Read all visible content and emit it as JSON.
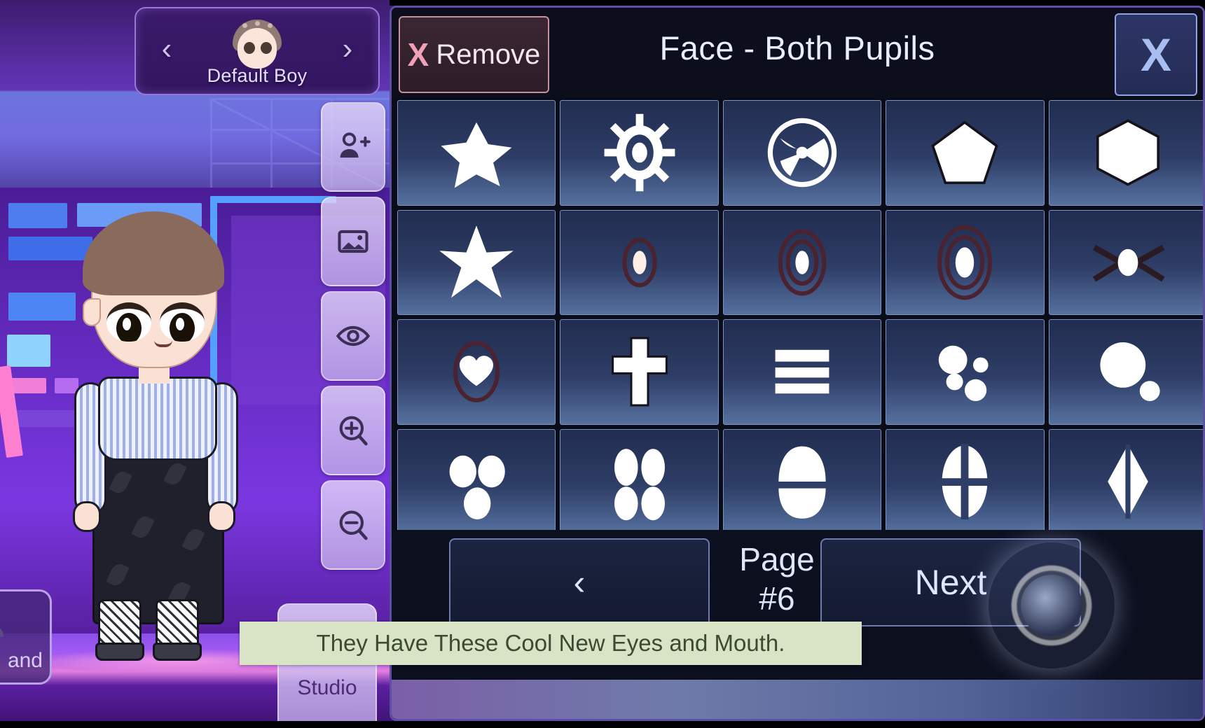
{
  "stage": {
    "selector": {
      "prev_label": "‹",
      "next_label": "›",
      "name": "Default Boy",
      "avatar_icon": "character-face-icon"
    },
    "rail": [
      {
        "name": "add-character",
        "icon": "person-plus-icon"
      },
      {
        "name": "background",
        "icon": "image-icon"
      },
      {
        "name": "preview-eye",
        "icon": "eye-icon"
      },
      {
        "name": "zoom-in",
        "icon": "magnifier-plus-icon"
      },
      {
        "name": "zoom-out",
        "icon": "magnifier-minus-icon"
      }
    ],
    "studio_button": {
      "label": "Studio",
      "icon": "camera-icon"
    },
    "rand_button": {
      "label": "and",
      "icon": "character-icon"
    }
  },
  "panel": {
    "remove_button": {
      "mark": "X",
      "label": "Remove"
    },
    "title": "Face - Both Pupils",
    "close_button": {
      "label": "X"
    },
    "items": [
      {
        "id": 1,
        "icon": "star-5-point-rough"
      },
      {
        "id": 2,
        "icon": "sun-burst-oval"
      },
      {
        "id": 3,
        "icon": "radiation-circle"
      },
      {
        "id": 4,
        "icon": "pentagon"
      },
      {
        "id": 5,
        "icon": "hexagon"
      },
      {
        "id": 6,
        "icon": "star-6-point"
      },
      {
        "id": 7,
        "icon": "oval-ring-small"
      },
      {
        "id": 8,
        "icon": "oval-double-ring"
      },
      {
        "id": 9,
        "icon": "oval-triple-ring"
      },
      {
        "id": 10,
        "icon": "sparkle-eye-lash"
      },
      {
        "id": 11,
        "icon": "heart-in-oval"
      },
      {
        "id": 12,
        "icon": "cross"
      },
      {
        "id": 13,
        "icon": "three-bars"
      },
      {
        "id": 14,
        "icon": "four-dot-cluster"
      },
      {
        "id": 15,
        "icon": "big-dot-small-dot"
      },
      {
        "id": 16,
        "icon": "three-circles"
      },
      {
        "id": 17,
        "icon": "four-ovals"
      },
      {
        "id": 18,
        "icon": "oval-split-horizontal"
      },
      {
        "id": 19,
        "icon": "oval-quartered"
      },
      {
        "id": 20,
        "icon": "diamond-split"
      }
    ],
    "footer": {
      "prev_label": "‹",
      "next_label": "Next",
      "page_label": "Page",
      "page_number": "#6"
    }
  },
  "caption": {
    "text": "They Have These Cool New Eyes and Mouth."
  },
  "colors": {
    "panel_bg": "#0a0c18",
    "panel_border": "#5d4fa6",
    "cell_top": "#212c4f",
    "cell_bottom": "#56719f",
    "remove_accent": "#f0a0b8",
    "caption_bg": "#d9e3c6",
    "caption_text": "#3d4a33",
    "stage_purple": "#6a2bc0"
  }
}
